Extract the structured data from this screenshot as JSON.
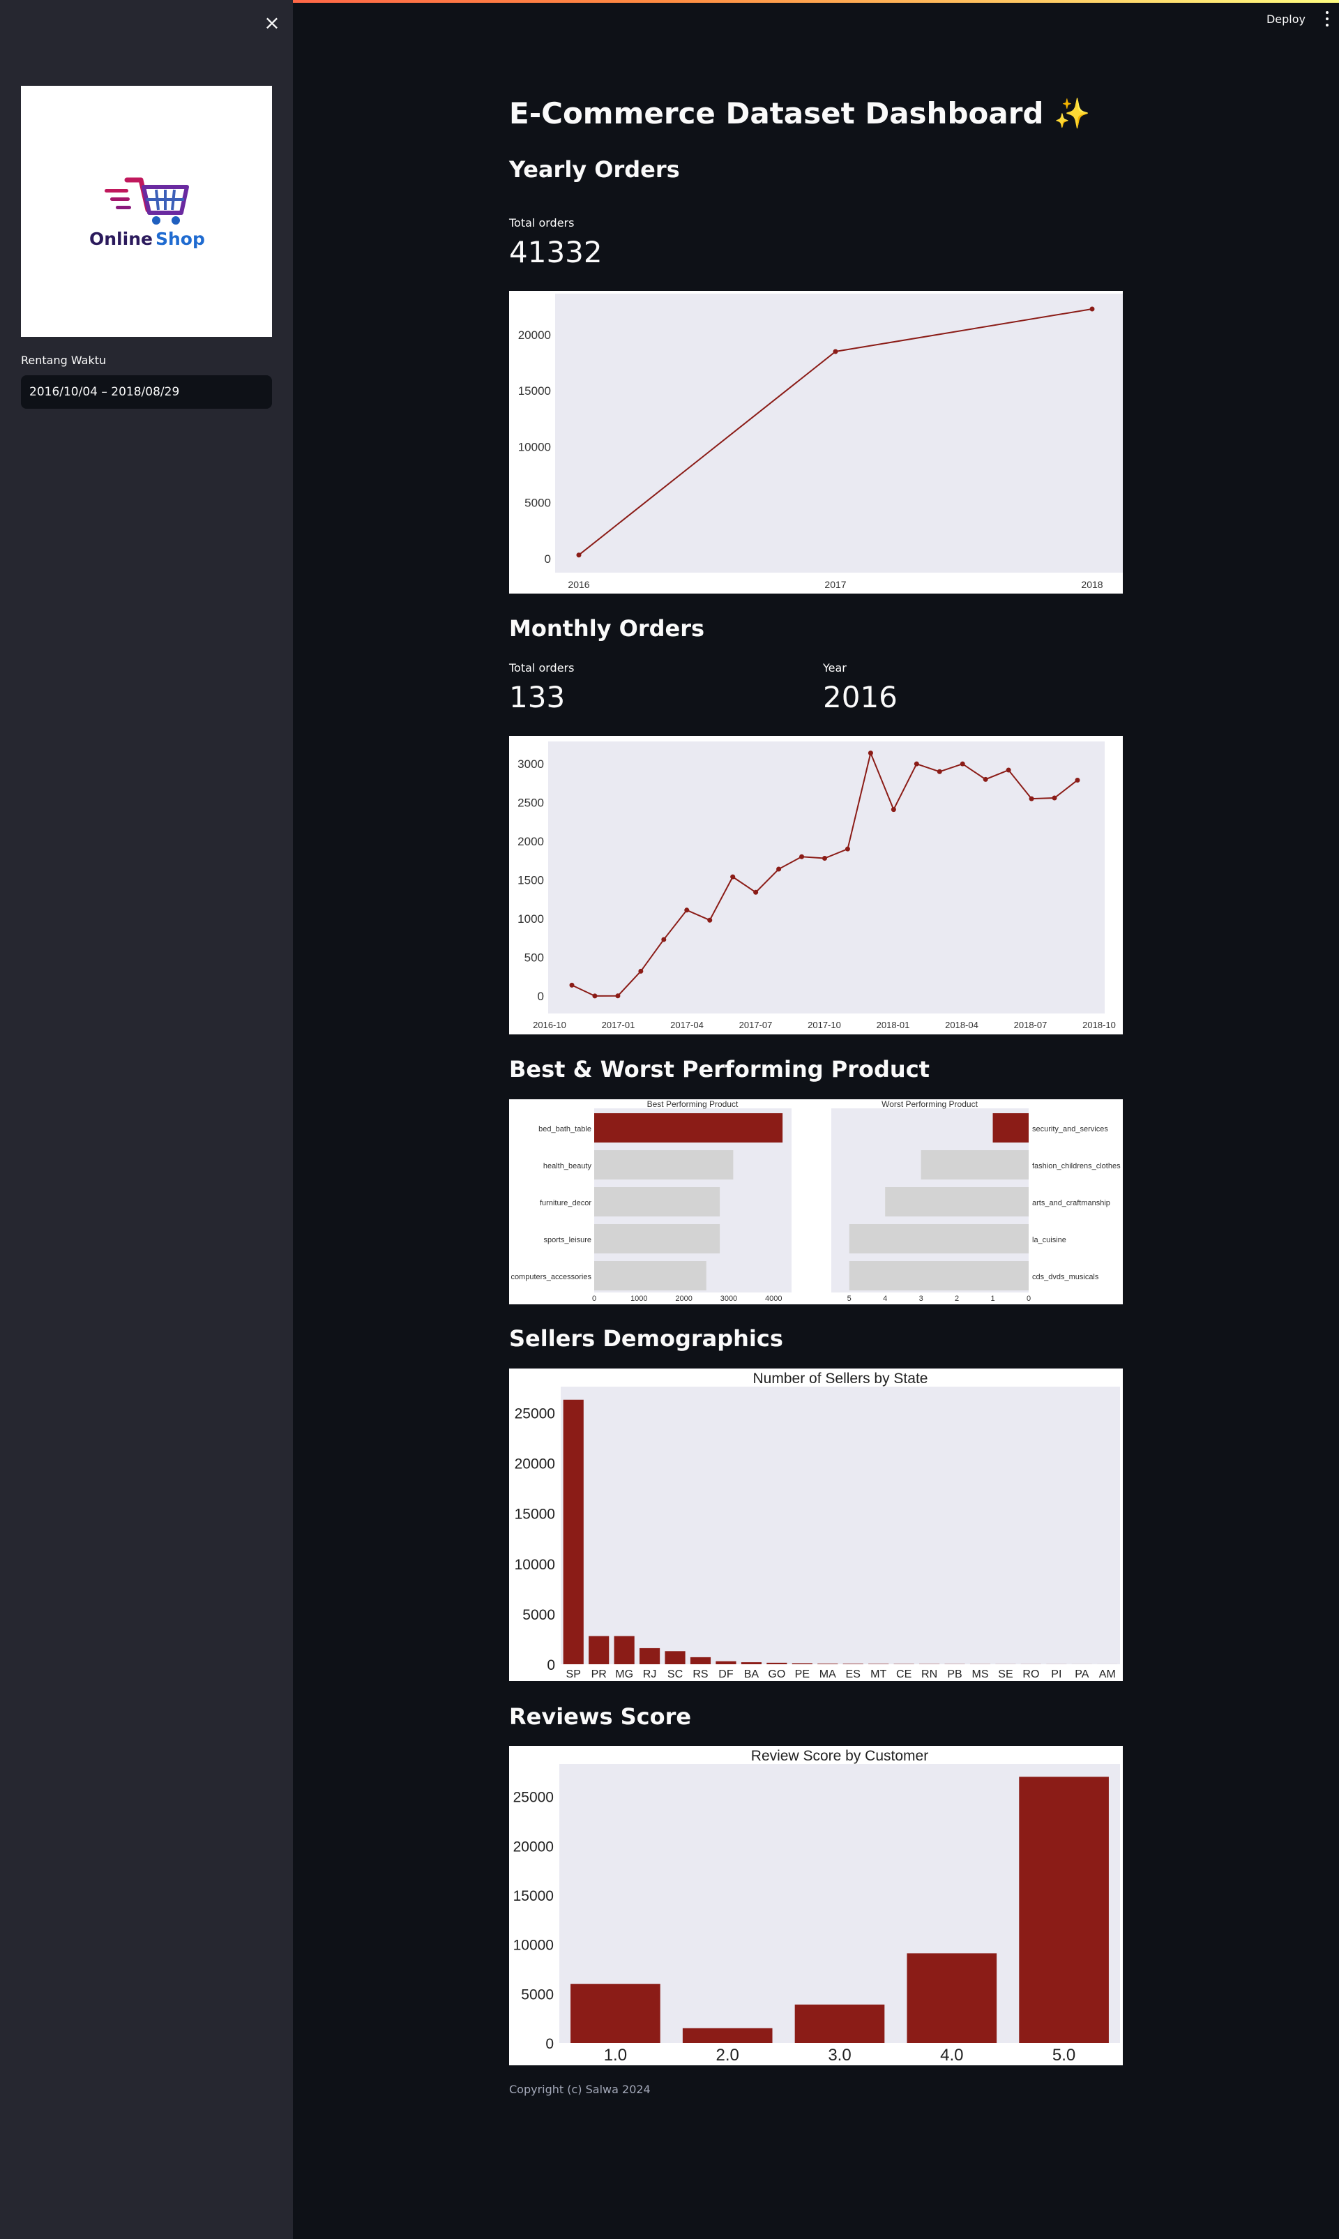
{
  "sidebar": {
    "close_icon": "close-icon",
    "logo": {
      "line1": "Online",
      "line2": "Shop"
    },
    "date_range_label": "Rentang Waktu",
    "date_range_value": "2016/10/04 – 2018/08/29"
  },
  "header": {
    "deploy_label": "Deploy",
    "menu_icon": "more-vertical-icon"
  },
  "main": {
    "title": "E-Commerce Dataset Dashboard ✨",
    "yearly": {
      "heading": "Yearly Orders",
      "metric_label": "Total orders",
      "metric_value": "41332"
    },
    "monthly": {
      "heading": "Monthly Orders",
      "metric_label": "Total orders",
      "metric_value": "133",
      "year_label": "Year",
      "year_value": "2016"
    },
    "products_heading": "Best & Worst Performing Product",
    "sellers_heading": "Sellers Demographics",
    "reviews_heading": "Reviews Score",
    "footer": "Copyright (c) Salwa 2024"
  },
  "colors": {
    "accent": "#8b1c17",
    "plot_bg": "#eaeaf2",
    "bar_gray": "#d3d3d3"
  },
  "chart_data": [
    {
      "id": "yearly",
      "type": "line",
      "x": [
        "2016",
        "2017",
        "2018"
      ],
      "values": [
        329,
        18500,
        22300
      ],
      "ylim": [
        0,
        22300
      ],
      "yticks": [
        0,
        5000,
        10000,
        15000,
        20000
      ],
      "grid": false
    },
    {
      "id": "monthly",
      "type": "line",
      "x": [
        "2016-10",
        "2016-11",
        "2016-12",
        "2017-01",
        "2017-02",
        "2017-03",
        "2017-04",
        "2017-05",
        "2017-06",
        "2017-07",
        "2017-08",
        "2017-09",
        "2017-10",
        "2017-11",
        "2017-12",
        "2018-01",
        "2018-02",
        "2018-03",
        "2018-04",
        "2018-05",
        "2018-06",
        "2018-07",
        "2018-08"
      ],
      "values": [
        140,
        0,
        1,
        320,
        730,
        1110,
        980,
        1540,
        1340,
        1640,
        1800,
        1780,
        1900,
        3140,
        2410,
        3000,
        2900,
        3000,
        2800,
        2920,
        2550,
        2560,
        2790
      ],
      "xticks": [
        "2016-10",
        "2017-01",
        "2017-04",
        "2017-07",
        "2017-10",
        "2018-01",
        "2018-04",
        "2018-07",
        "2018-10"
      ],
      "yticks": [
        0,
        500,
        1000,
        1500,
        2000,
        2500,
        3000
      ],
      "ylim": [
        -100,
        3200
      ],
      "grid": false
    },
    {
      "id": "best",
      "type": "bar",
      "orientation": "horizontal",
      "title": "Best Performing Product",
      "categories": [
        "bed_bath_table",
        "health_beauty",
        "furniture_decor",
        "sports_leisure",
        "computers_accessories"
      ],
      "values": [
        4200,
        3100,
        2800,
        2800,
        2500
      ],
      "xticks": [
        0,
        1000,
        2000,
        3000,
        4000
      ],
      "xlim": [
        0,
        4400
      ]
    },
    {
      "id": "worst",
      "type": "bar",
      "orientation": "horizontal",
      "title": "Worst Performing Product",
      "categories": [
        "security_and_services",
        "fashion_childrens_clothes",
        "arts_and_craftmanship",
        "la_cuisine",
        "cds_dvds_musicals"
      ],
      "values": [
        1,
        3,
        4,
        5,
        5
      ],
      "xticks": [
        5,
        4,
        3,
        2,
        1,
        0
      ],
      "xlim": [
        0,
        5.5
      ],
      "x_inverted": true
    },
    {
      "id": "sellers",
      "type": "bar",
      "title": "Number of Sellers by State",
      "categories": [
        "SP",
        "PR",
        "MG",
        "RJ",
        "SC",
        "RS",
        "DF",
        "BA",
        "GO",
        "PE",
        "MA",
        "ES",
        "MT",
        "CE",
        "RN",
        "PB",
        "MS",
        "SE",
        "RO",
        "PI",
        "PA",
        "AM"
      ],
      "values": [
        26300,
        2800,
        2800,
        1600,
        1300,
        700,
        300,
        200,
        150,
        100,
        60,
        50,
        40,
        30,
        25,
        20,
        15,
        10,
        10,
        8,
        5,
        3
      ],
      "yticks": [
        0,
        5000,
        10000,
        15000,
        20000,
        25000
      ],
      "ylim": [
        0,
        27600
      ]
    },
    {
      "id": "reviews",
      "type": "bar",
      "title": "Review Score by Customer",
      "categories": [
        "1.0",
        "2.0",
        "3.0",
        "4.0",
        "5.0"
      ],
      "values": [
        6000,
        1500,
        3900,
        9100,
        27000
      ],
      "yticks": [
        0,
        5000,
        10000,
        15000,
        20000,
        25000
      ],
      "ylim": [
        0,
        28300
      ]
    }
  ]
}
